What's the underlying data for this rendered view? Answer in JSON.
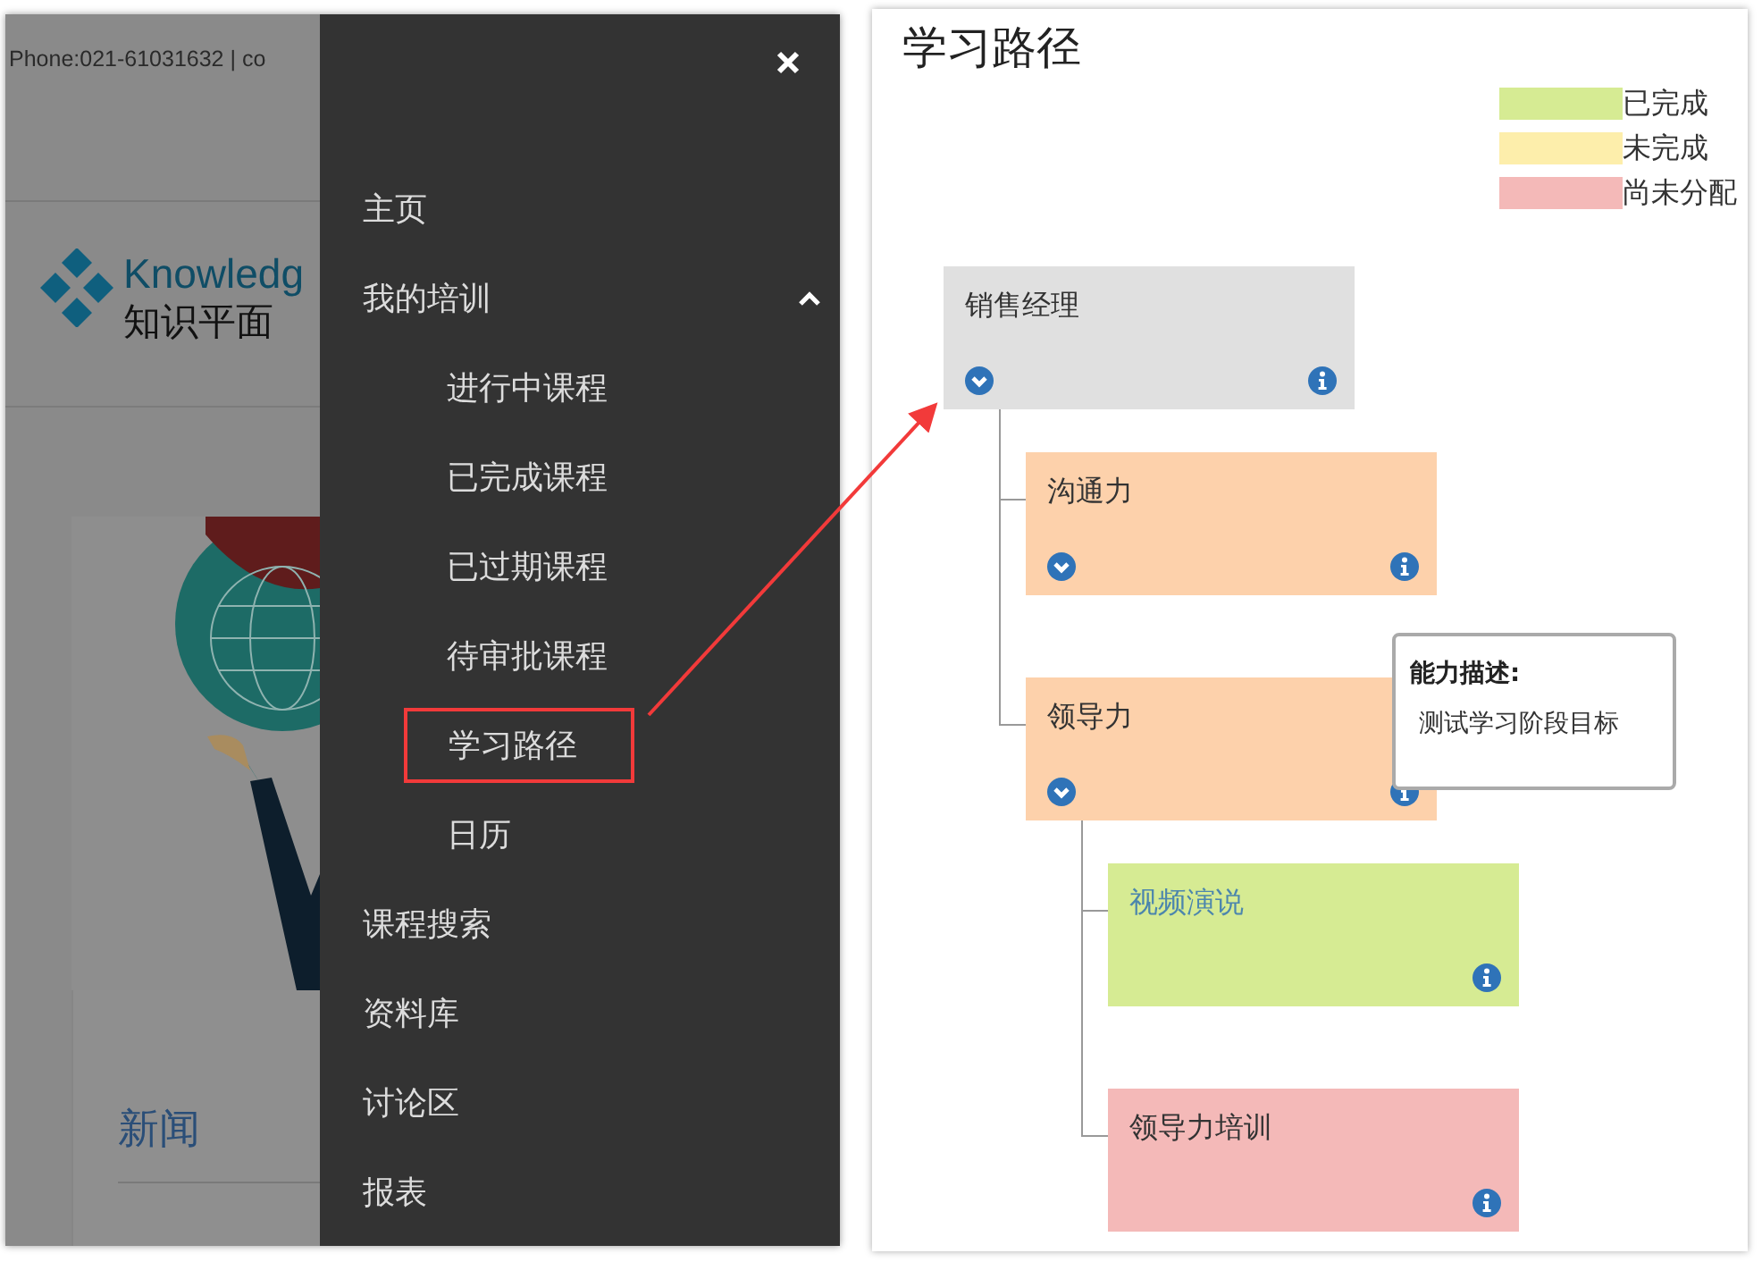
{
  "left_page": {
    "contact": "Phone:021-61031632 | co",
    "logo_text": "Knowledg",
    "logo_subtitle": "知识平面",
    "news_title": "新闻"
  },
  "menu": {
    "items": [
      {
        "label": "主页",
        "highlighted": false
      },
      {
        "label": "我的培训",
        "highlighted": false,
        "expanded": true,
        "children": [
          {
            "label": "进行中课程",
            "highlighted": false
          },
          {
            "label": "已完成课程",
            "highlighted": false
          },
          {
            "label": "已过期课程",
            "highlighted": false
          },
          {
            "label": "待审批课程",
            "highlighted": false
          },
          {
            "label": "学习路径",
            "highlighted": true
          },
          {
            "label": "日历",
            "highlighted": false
          }
        ]
      },
      {
        "label": "课程搜索",
        "highlighted": false
      },
      {
        "label": "资料库",
        "highlighted": false
      },
      {
        "label": "讨论区",
        "highlighted": false
      },
      {
        "label": "报表",
        "highlighted": false
      }
    ]
  },
  "learning_path": {
    "title": "学习路径",
    "legend": [
      {
        "label": "已完成",
        "color": "#d6eb93"
      },
      {
        "label": "未完成",
        "color": "#fdeeab"
      },
      {
        "label": "尚未分配",
        "color": "#f4b9b8"
      }
    ],
    "tree": {
      "label": "销售经理",
      "color": "#e0e0e0",
      "expandable": true,
      "linked": false,
      "children": [
        {
          "label": "沟通力",
          "color": "#fdd1ab",
          "expandable": true,
          "linked": false
        },
        {
          "label": "领导力",
          "color": "#fdd1ab",
          "expandable": true,
          "linked": false,
          "children": [
            {
              "label": "视频演说",
              "color": "#d6eb93",
              "expandable": false,
              "linked": true
            },
            {
              "label": "领导力培训",
              "color": "#f4b9b8",
              "expandable": false,
              "linked": false
            }
          ]
        }
      ]
    },
    "tooltip": {
      "title": "能力描述:",
      "text": "测试学习阶段目标"
    }
  }
}
